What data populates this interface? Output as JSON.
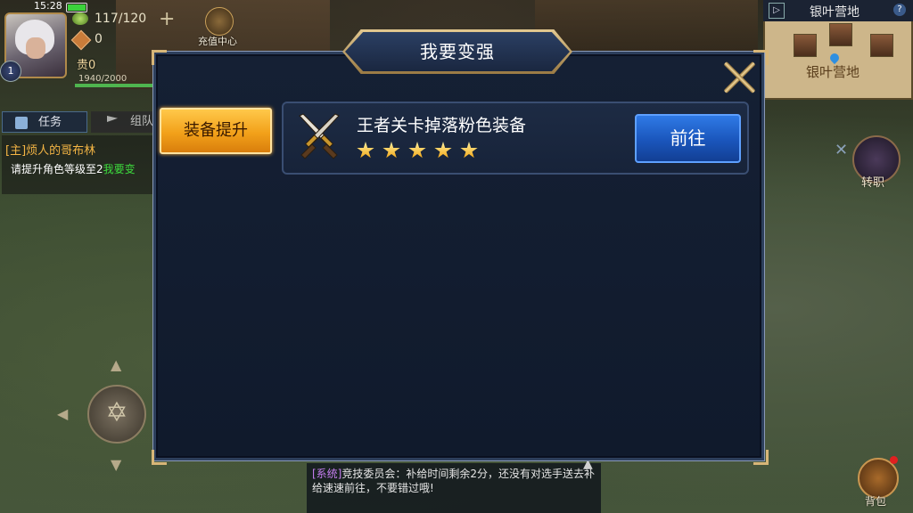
{
  "status": {
    "time": "15:28",
    "battery_percent": 90
  },
  "player": {
    "level": "1",
    "energy": "117/120",
    "coins": "0",
    "vip": "贵0",
    "exp": "1940/2000",
    "exp_fraction": 0.97
  },
  "recharge": {
    "label": "充值中心"
  },
  "task_panel": {
    "tab_task": "任务",
    "tab_team": "组队",
    "quest_title": "[主]烦人的哥布林",
    "quest_desc": "请提升角色等级至2",
    "quest_link": "我要变"
  },
  "minimap": {
    "title": "银叶营地",
    "place": "银叶营地",
    "help": "?"
  },
  "side_buttons": {
    "job": "转职",
    "bag": "背包"
  },
  "chat": {
    "tag": "[系统]",
    "message": "竞技委员会：补给时间剩余2分，还没有对选手送去补给速速前往，不要错过哦!"
  },
  "dialog": {
    "title": "我要变强",
    "side_tab": "装备提升",
    "rows": [
      {
        "text": "王者关卡掉落粉色装备",
        "stars": 5,
        "button": "前往",
        "icon": "crossed-swords-icon"
      }
    ]
  },
  "colors": {
    "accent_gold": "#f2a11a",
    "button_blue": "#1a55bb",
    "dialog_bg": "#152034",
    "quest_title": "#f4b544",
    "chat_tag": "#c57ef0"
  }
}
